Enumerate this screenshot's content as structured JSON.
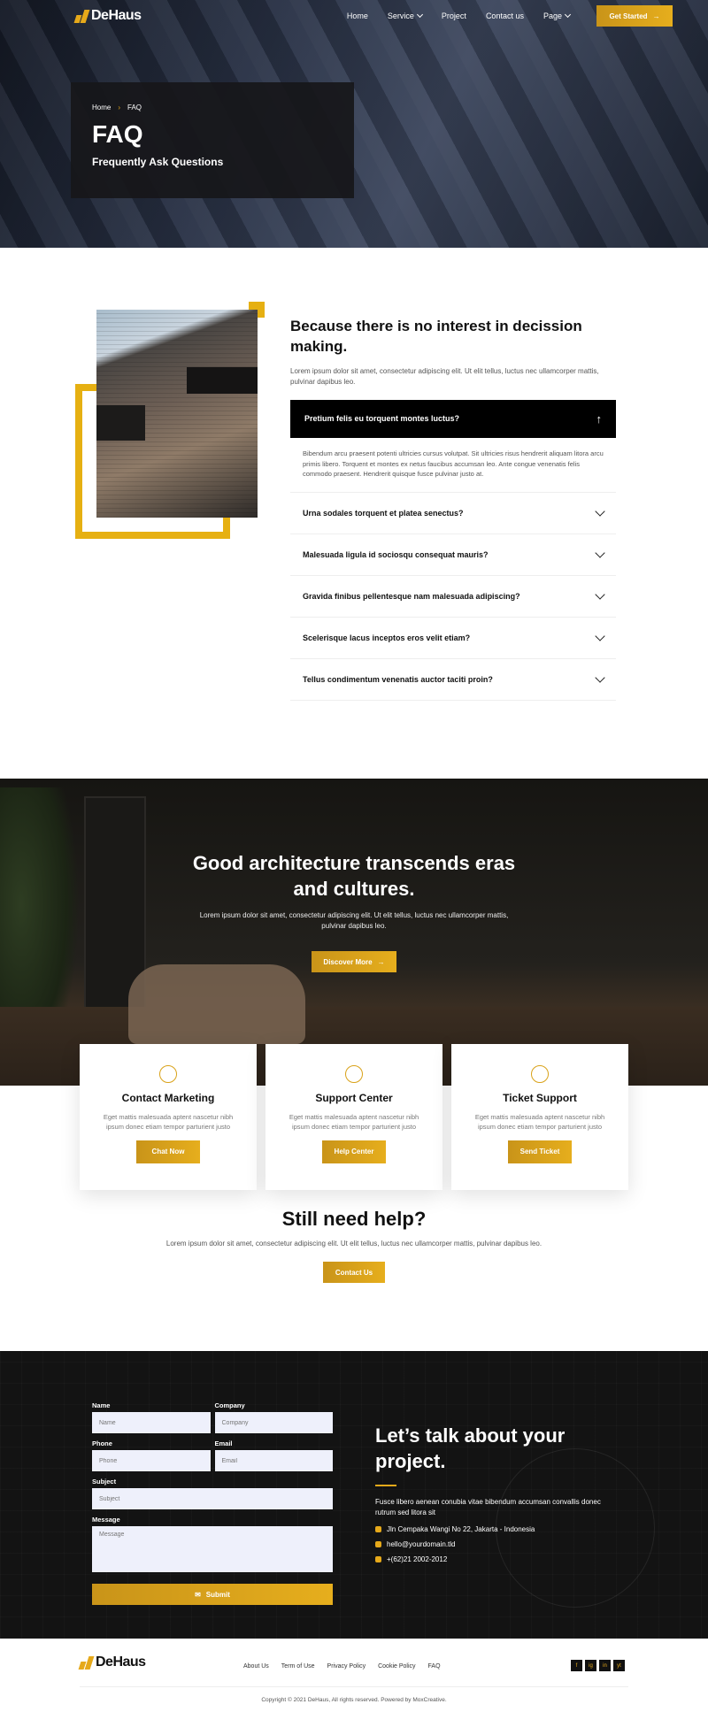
{
  "nav": {
    "logo": "DeHaus",
    "items": [
      "Home",
      "Service",
      "Project",
      "Contact us",
      "Page"
    ],
    "cta": "Get Started"
  },
  "hero": {
    "breadcrumb": [
      "Home",
      "FAQ"
    ],
    "title": "FAQ",
    "subtitle": "Frequently Ask Questions"
  },
  "faq": {
    "heading": "Because there is no interest in decission making.",
    "lead": "Lorem ipsum dolor sit amet, consectetur adipiscing elit. Ut elit tellus, luctus nec ullamcorper mattis, pulvinar dapibus leo.",
    "open": {
      "question": "Pretium felis eu torquent montes luctus?",
      "answer": "Bibendum arcu praesent potenti ultricies cursus volutpat. Sit ultricies risus hendrerit aliquam litora arcu primis libero. Torquent et montes ex netus faucibus accumsan leo. Ante congue venenatis felis commodo praesent. Hendrerit quisque fusce pulvinar justo at."
    },
    "items": [
      "Urna sodales torquent et platea senectus?",
      "Malesuada ligula id sociosqu consequat mauris?",
      "Gravida finibus pellentesque nam malesuada adipiscing?",
      "Scelerisque lacus inceptos eros velit etiam?",
      "Tellus condimentum venenatis auctor taciti proin?"
    ]
  },
  "arch": {
    "heading_line1": "Good architecture transcends eras",
    "heading_line2": "and cultures.",
    "text": "Lorem ipsum dolor sit amet, consectetur adipiscing elit. Ut elit tellus, luctus nec ullamcorper mattis, pulvinar dapibus leo.",
    "button": "Discover More"
  },
  "cards": [
    {
      "icon": "headset-icon",
      "title": "Contact Marketing",
      "text": "Eget mattis malesuada aptent nascetur nibh ipsum donec etiam tempor parturient justo",
      "button": "Chat Now"
    },
    {
      "icon": "chat-icon",
      "title": "Support Center",
      "text": "Eget mattis malesuada aptent nascetur nibh ipsum donec etiam tempor parturient justo",
      "button": "Help Center"
    },
    {
      "icon": "ticket-icon",
      "title": "Ticket Support",
      "text": "Eget mattis malesuada aptent nascetur nibh ipsum donec etiam tempor parturient justo",
      "button": "Send Ticket"
    }
  ],
  "help": {
    "heading": "Still need help?",
    "text": "Lorem ipsum dolor sit amet, consectetur adipiscing elit. Ut elit tellus, luctus nec ullamcorper mattis, pulvinar dapibus leo.",
    "button": "Contact Us"
  },
  "form": {
    "name_label": "Name",
    "name_ph": "Name",
    "company_label": "Company",
    "company_ph": "Company",
    "phone_label": "Phone",
    "phone_ph": "Phone",
    "email_label": "Email",
    "email_ph": "Email",
    "subject_label": "Subject",
    "subject_ph": "Subject",
    "message_label": "Message",
    "message_ph": "Message",
    "submit": "Submit"
  },
  "talk": {
    "heading": "Let’s talk about your project.",
    "text": "Fusce libero aenean conubia vitae bibendum accumsan convallis donec rutrum sed litora sit",
    "address": "Jln Cempaka Wangi No 22, Jakarta - Indonesia",
    "email": "hello@yourdomain.tld",
    "phone": "+(62)21 2002-2012"
  },
  "footer": {
    "logo": "DeHaus",
    "links": [
      "About Us",
      "Term of Use",
      "Privacy Policy",
      "Cookie Policy",
      "FAQ"
    ],
    "social": [
      "f",
      "ig",
      "in",
      "yt"
    ],
    "copyright": "Copyright © 2021 DeHaus, All rights reserved. Powered by MoxCreative."
  },
  "colors": {
    "accent": "#e6a91a",
    "dark": "#131313"
  }
}
